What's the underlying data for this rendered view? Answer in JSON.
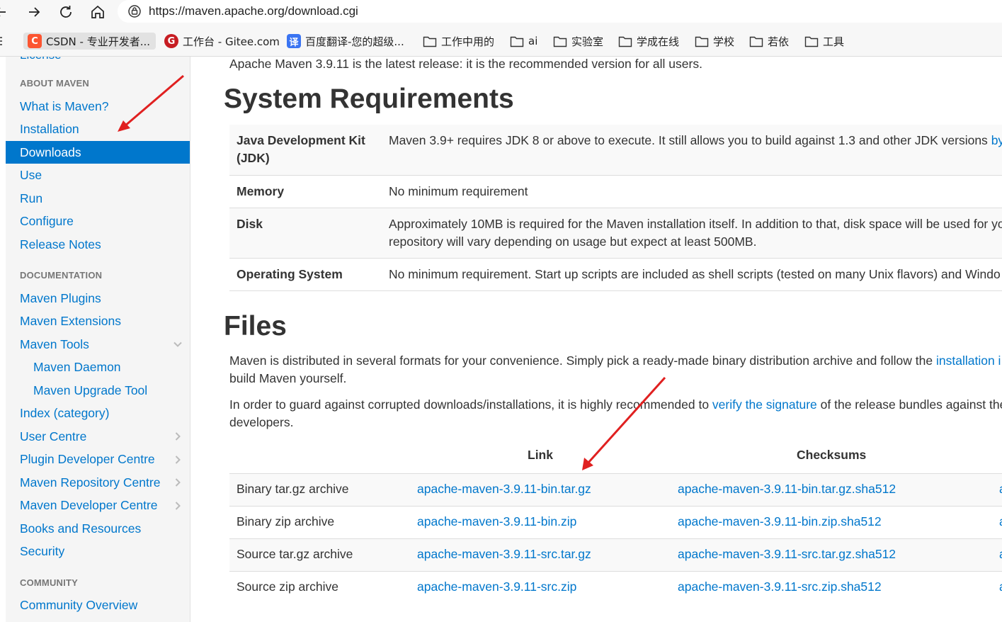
{
  "browser": {
    "url": "https://maven.apache.org/download.cgi",
    "bookmarks": [
      {
        "label": "CSDN - 专业开发者...",
        "icon": "csdn-favicon",
        "color": "#fc5531",
        "glyph": "C"
      },
      {
        "label": "工作台 - Gitee.com",
        "icon": "gitee-favicon",
        "color": "#c71d23",
        "glyph": "G"
      },
      {
        "label": "百度翻译-您的超级...",
        "icon": "baidu-translate-favicon",
        "color": "#3a74f2",
        "glyph": "译"
      },
      {
        "label": "工作中用的",
        "icon": "folder-icon"
      },
      {
        "label": "ai",
        "icon": "folder-icon"
      },
      {
        "label": "实验室",
        "icon": "folder-icon"
      },
      {
        "label": "学成在线",
        "icon": "folder-icon"
      },
      {
        "label": "学校",
        "icon": "folder-icon"
      },
      {
        "label": "若依",
        "icon": "folder-icon"
      },
      {
        "label": "工具",
        "icon": "folder-icon"
      }
    ]
  },
  "sidebar": {
    "cut_item": "License",
    "about_header": "ABOUT MAVEN",
    "about_items": [
      {
        "label": "What is Maven?"
      },
      {
        "label": "Installation"
      },
      {
        "label": "Downloads",
        "active": true
      },
      {
        "label": "Use"
      },
      {
        "label": "Run"
      },
      {
        "label": "Configure"
      },
      {
        "label": "Release Notes"
      }
    ],
    "docs_header": "DOCUMENTATION",
    "docs_items": [
      {
        "label": "Maven Plugins"
      },
      {
        "label": "Maven Extensions"
      },
      {
        "label": "Maven Tools",
        "chevron": "down"
      },
      {
        "label": "Maven Daemon",
        "sub": true
      },
      {
        "label": "Maven Upgrade Tool",
        "sub": true
      },
      {
        "label": "Index (category)"
      },
      {
        "label": "User Centre",
        "chevron": "right"
      },
      {
        "label": "Plugin Developer Centre",
        "chevron": "right"
      },
      {
        "label": "Maven Repository Centre",
        "chevron": "right"
      },
      {
        "label": "Maven Developer Centre",
        "chevron": "right"
      },
      {
        "label": "Books and Resources"
      },
      {
        "label": "Security"
      }
    ],
    "community_header": "COMMUNITY",
    "community_items": [
      {
        "label": "Community Overview"
      }
    ]
  },
  "main": {
    "intro": "Apache Maven 3.9.11 is the latest release: it is the recommended version for all users.",
    "sysreq_title": "System Requirements",
    "requirements": [
      {
        "key": "Java Development Kit (JDK)",
        "value": "Maven 3.9+ requires JDK 8 or above to execute. It still allows you to build against 1.3 and other JDK versions",
        "link": "by"
      },
      {
        "key": "Memory",
        "value": "No minimum requirement"
      },
      {
        "key": "Disk",
        "value": "Approximately 10MB is required for the Maven installation itself. In addition to that, disk space will be used for yo",
        "value2": "repository will vary depending on usage but expect at least 500MB."
      },
      {
        "key": "Operating System",
        "value": "No minimum requirement. Start up scripts are included as shell scripts (tested on many Unix flavors) and Windo"
      }
    ],
    "files_title": "Files",
    "files_p1_a": "Maven is distributed in several formats for your convenience. Simply pick a ready-made binary distribution archive and follow the ",
    "files_p1_link": "installation i",
    "files_p1_b": "build Maven yourself.",
    "files_p2_a": "In order to guard against corrupted downloads/installations, it is highly recommended to ",
    "files_p2_link": "verify the signature",
    "files_p2_b": " of the release bundles against the",
    "files_p2_c": "developers.",
    "files_headers": {
      "link": "Link",
      "checksums": "Checksums"
    },
    "files": [
      {
        "name": "Binary tar.gz archive",
        "link": "apache-maven-3.9.11-bin.tar.gz",
        "checksum": "apache-maven-3.9.11-bin.tar.gz.sha512",
        "sig": "a"
      },
      {
        "name": "Binary zip archive",
        "link": "apache-maven-3.9.11-bin.zip",
        "checksum": "apache-maven-3.9.11-bin.zip.sha512",
        "sig": "a"
      },
      {
        "name": "Source tar.gz archive",
        "link": "apache-maven-3.9.11-src.tar.gz",
        "checksum": "apache-maven-3.9.11-src.tar.gz.sha512",
        "sig": "a"
      },
      {
        "name": "Source zip archive",
        "link": "apache-maven-3.9.11-src.zip",
        "checksum": "apache-maven-3.9.11-src.zip.sha512",
        "sig": "a"
      }
    ]
  },
  "colors": {
    "link": "#0077cc",
    "active_bg": "#0077cc",
    "annotation_arrow": "#e02020"
  }
}
